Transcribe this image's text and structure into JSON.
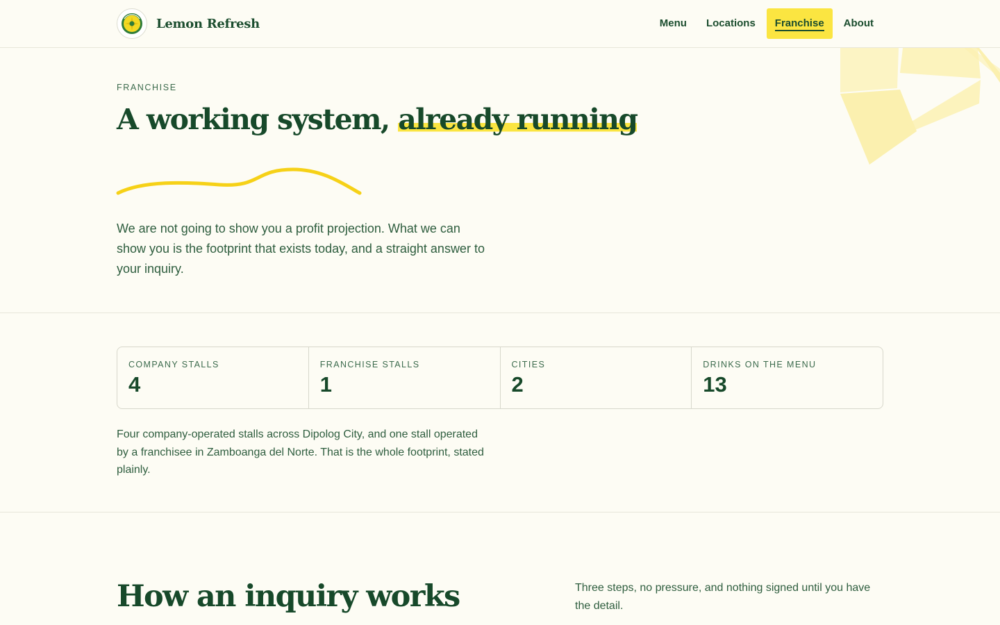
{
  "brand": {
    "name": "Lemon Refresh",
    "logo_icon": "lemon-logo-icon"
  },
  "nav": {
    "items": [
      {
        "label": "Menu",
        "active": false
      },
      {
        "label": "Locations",
        "active": false
      },
      {
        "label": "Franchise",
        "active": true
      },
      {
        "label": "About",
        "active": false
      }
    ]
  },
  "hero": {
    "eyebrow": "FRANCHISE",
    "title_plain": "A working system, ",
    "title_highlight": "already running",
    "body": "We are not going to show you a profit projection. What we can show you is the footprint that exists today, and a straight answer to your inquiry."
  },
  "stats": {
    "items": [
      {
        "label": "COMPANY STALLS",
        "value": "4"
      },
      {
        "label": "FRANCHISE STALLS",
        "value": "1"
      },
      {
        "label": "CITIES",
        "value": "2"
      },
      {
        "label": "DRINKS ON THE MENU",
        "value": "13"
      }
    ],
    "note": "Four company-operated stalls across Dipolog City, and one stall operated by a franchisee in Zamboanga del Norte. That is the whole footprint, stated plainly."
  },
  "inquiry": {
    "heading": "How an inquiry works",
    "intro": "Three steps, no pressure, and nothing signed until you have the detail."
  },
  "colors": {
    "background": "#fdfcf4",
    "accent_yellow": "#fbe541",
    "brand_green": "#17492a"
  }
}
